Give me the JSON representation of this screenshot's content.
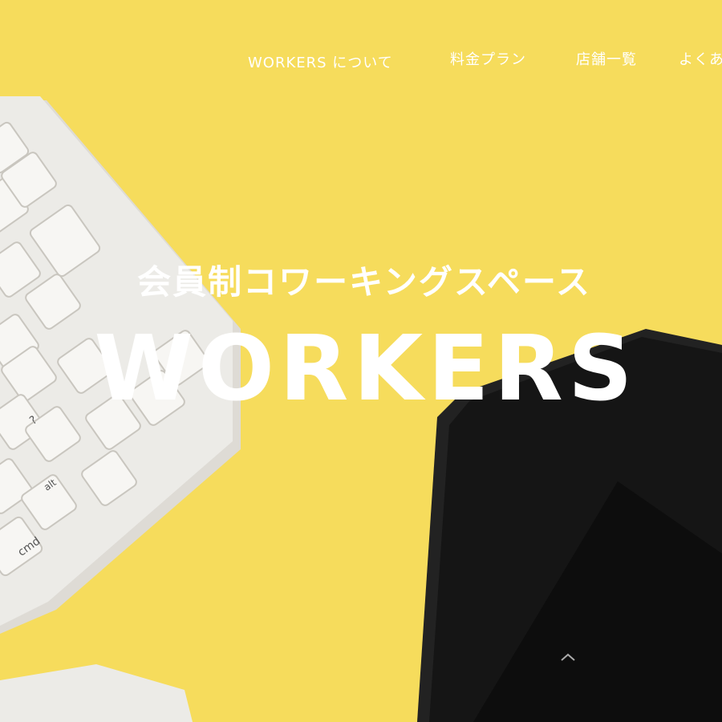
{
  "nav": {
    "items": [
      {
        "label": "WORKERS について"
      },
      {
        "label": "料金プラン"
      },
      {
        "label": "店舗一覧"
      },
      {
        "label": "よくあ"
      }
    ]
  },
  "hero": {
    "subtitle": "会員制コワーキングスペース",
    "title": "WORKERS"
  },
  "keyboard": {
    "key_cmd": "cmd",
    "key_alt": "alt",
    "key_question": "?"
  },
  "colors": {
    "background": "#f6dc5c",
    "text": "#ffffff",
    "keyboard": "#e9e7e3",
    "tablet": "#1b1b1b"
  }
}
